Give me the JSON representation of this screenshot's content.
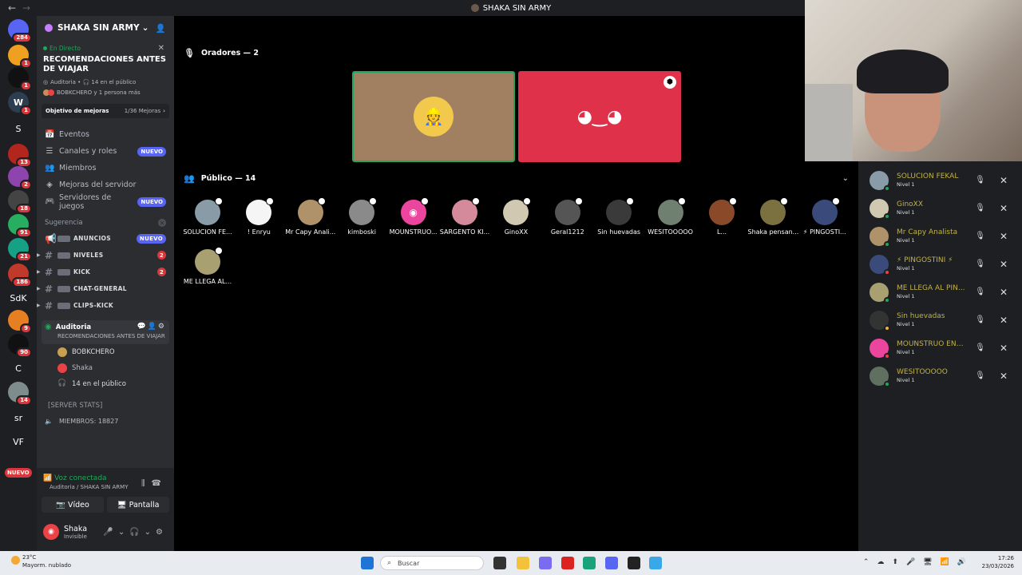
{
  "titlebar": {
    "title": "SHAKA SIN ARMY"
  },
  "rail": {
    "servers": [
      {
        "label": "",
        "badge": "284",
        "color": "#5865f2"
      },
      {
        "label": "",
        "badge": "1",
        "color": "#f0a020"
      },
      {
        "label": "",
        "badge": "1",
        "color": "#111111"
      },
      {
        "label": "W",
        "badge": "1",
        "color": "#2c3e50"
      },
      {
        "label": "S",
        "badge": "",
        "color": "transparent"
      },
      {
        "label": "",
        "badge": "13",
        "color": "#b3261e"
      },
      {
        "label": "",
        "badge": "2",
        "color": "#8e44ad"
      },
      {
        "label": "",
        "badge": "18",
        "color": "#444"
      },
      {
        "label": "",
        "badge": "91",
        "color": "#27ae60"
      },
      {
        "label": "",
        "badge": "21",
        "color": "#16a085"
      },
      {
        "label": "",
        "badge": "186",
        "color": "#c0392b"
      },
      {
        "label": "SdK",
        "badge": "",
        "color": "transparent"
      },
      {
        "label": "",
        "badge": "9",
        "color": "#e67e22"
      },
      {
        "label": "",
        "badge": "90",
        "color": "#111"
      },
      {
        "label": "C",
        "badge": "",
        "color": "transparent"
      },
      {
        "label": "",
        "badge": "14",
        "color": "#7f8c8d"
      },
      {
        "label": "sr",
        "badge": "",
        "color": "transparent"
      },
      {
        "label": "VF",
        "badge": "",
        "color": "transparent"
      }
    ],
    "nuevo": "NUEVO"
  },
  "sidebar": {
    "guild_name": "SHAKA SIN ARMY",
    "live": {
      "status": "En Directo",
      "title": "RECOMENDACIONES ANTES DE VIAJAR",
      "meta": "Auditoria • 🎧 14 en el público",
      "listeners": "BOBKCHERO y 1 persona más"
    },
    "goal": {
      "label": "Objetivo de mejoras",
      "value": "1/36 Mejoras"
    },
    "menu": [
      {
        "icon": "📅",
        "label": "Eventos",
        "badge": ""
      },
      {
        "icon": "☰",
        "label": "Canales y roles",
        "badge": "NUEVO"
      },
      {
        "icon": "👥",
        "label": "Miembros",
        "badge": ""
      },
      {
        "icon": "◈",
        "label": "Mejoras del servidor",
        "badge": ""
      },
      {
        "icon": "🎮",
        "label": "Servidores de juegos",
        "badge": "NUEVO"
      }
    ],
    "section": "Sugerencia",
    "channels": [
      {
        "label": "ANUNCIOS",
        "badge": "NUEVO"
      },
      {
        "label": "NIVELES",
        "badge": "2"
      },
      {
        "label": "KICK",
        "badge": "2"
      },
      {
        "label": "CHAT-GENERAL",
        "badge": ""
      },
      {
        "label": "CLIPS-KICK",
        "badge": ""
      }
    ],
    "stage": {
      "name": "Auditoria",
      "subtitle": "RECOMENDACIONES ANTES DE VIAJAR"
    },
    "stage_users": [
      "BOBKCHERO",
      "Shaka",
      "14 en el público"
    ],
    "stats_header": "[SERVER STATS]",
    "members": "MIEMBROS: 18827",
    "voice": {
      "status": "Voz conectada",
      "where": "Auditoria / SHAKA SIN ARMY",
      "video": "Vídeo",
      "screen": "Pantalla"
    },
    "user": {
      "name": "Shaka",
      "status": "Invisible"
    }
  },
  "main": {
    "speakers_header": "Oradores — 2",
    "audience_header": "Público — 14",
    "audience": [
      "SOLUCION FE...",
      "! Enryu",
      "Mr Capy Anali...",
      "kimboski",
      "MOUNSTRUO...",
      "SARGENTO KI...",
      "GinoXX",
      "Geral1212",
      "Sin huevadas",
      "WESITOOOOO",
      "L...",
      "Shaka pensan...",
      "⚡ PINGOSTI...",
      "ME LLEGA AL..."
    ]
  },
  "right_panel": {
    "users": [
      {
        "name": "SOLUCION FEKAL",
        "level": "Nivel 1",
        "color": "#8a9ba8"
      },
      {
        "name": "GinoXX",
        "level": "Nivel 1",
        "color": "#d0c8b0"
      },
      {
        "name": "Mr Capy Analista",
        "level": "Nivel 1",
        "color": "#b0926a"
      },
      {
        "name": "⚡ PINGOSTINI ⚡",
        "level": "Nivel 1",
        "color": "#3a4a7a"
      },
      {
        "name": "ME LLEGA AL PIN...",
        "level": "Nivel 1",
        "color": "#a8a070"
      },
      {
        "name": "Sin huevadas",
        "level": "Nivel 1",
        "color": "#333333"
      },
      {
        "name": "MOUNSTRUO EN ...",
        "level": "Nivel 1",
        "color": "#eb459e"
      },
      {
        "name": "WESITOOOOO",
        "level": "Nivel 1",
        "color": "#607060"
      }
    ]
  },
  "taskbar": {
    "weather_temp": "23°C",
    "weather_desc": "Mayorm. nublado",
    "search": "Buscar",
    "time": "17:26",
    "date": "23/03/2026"
  }
}
